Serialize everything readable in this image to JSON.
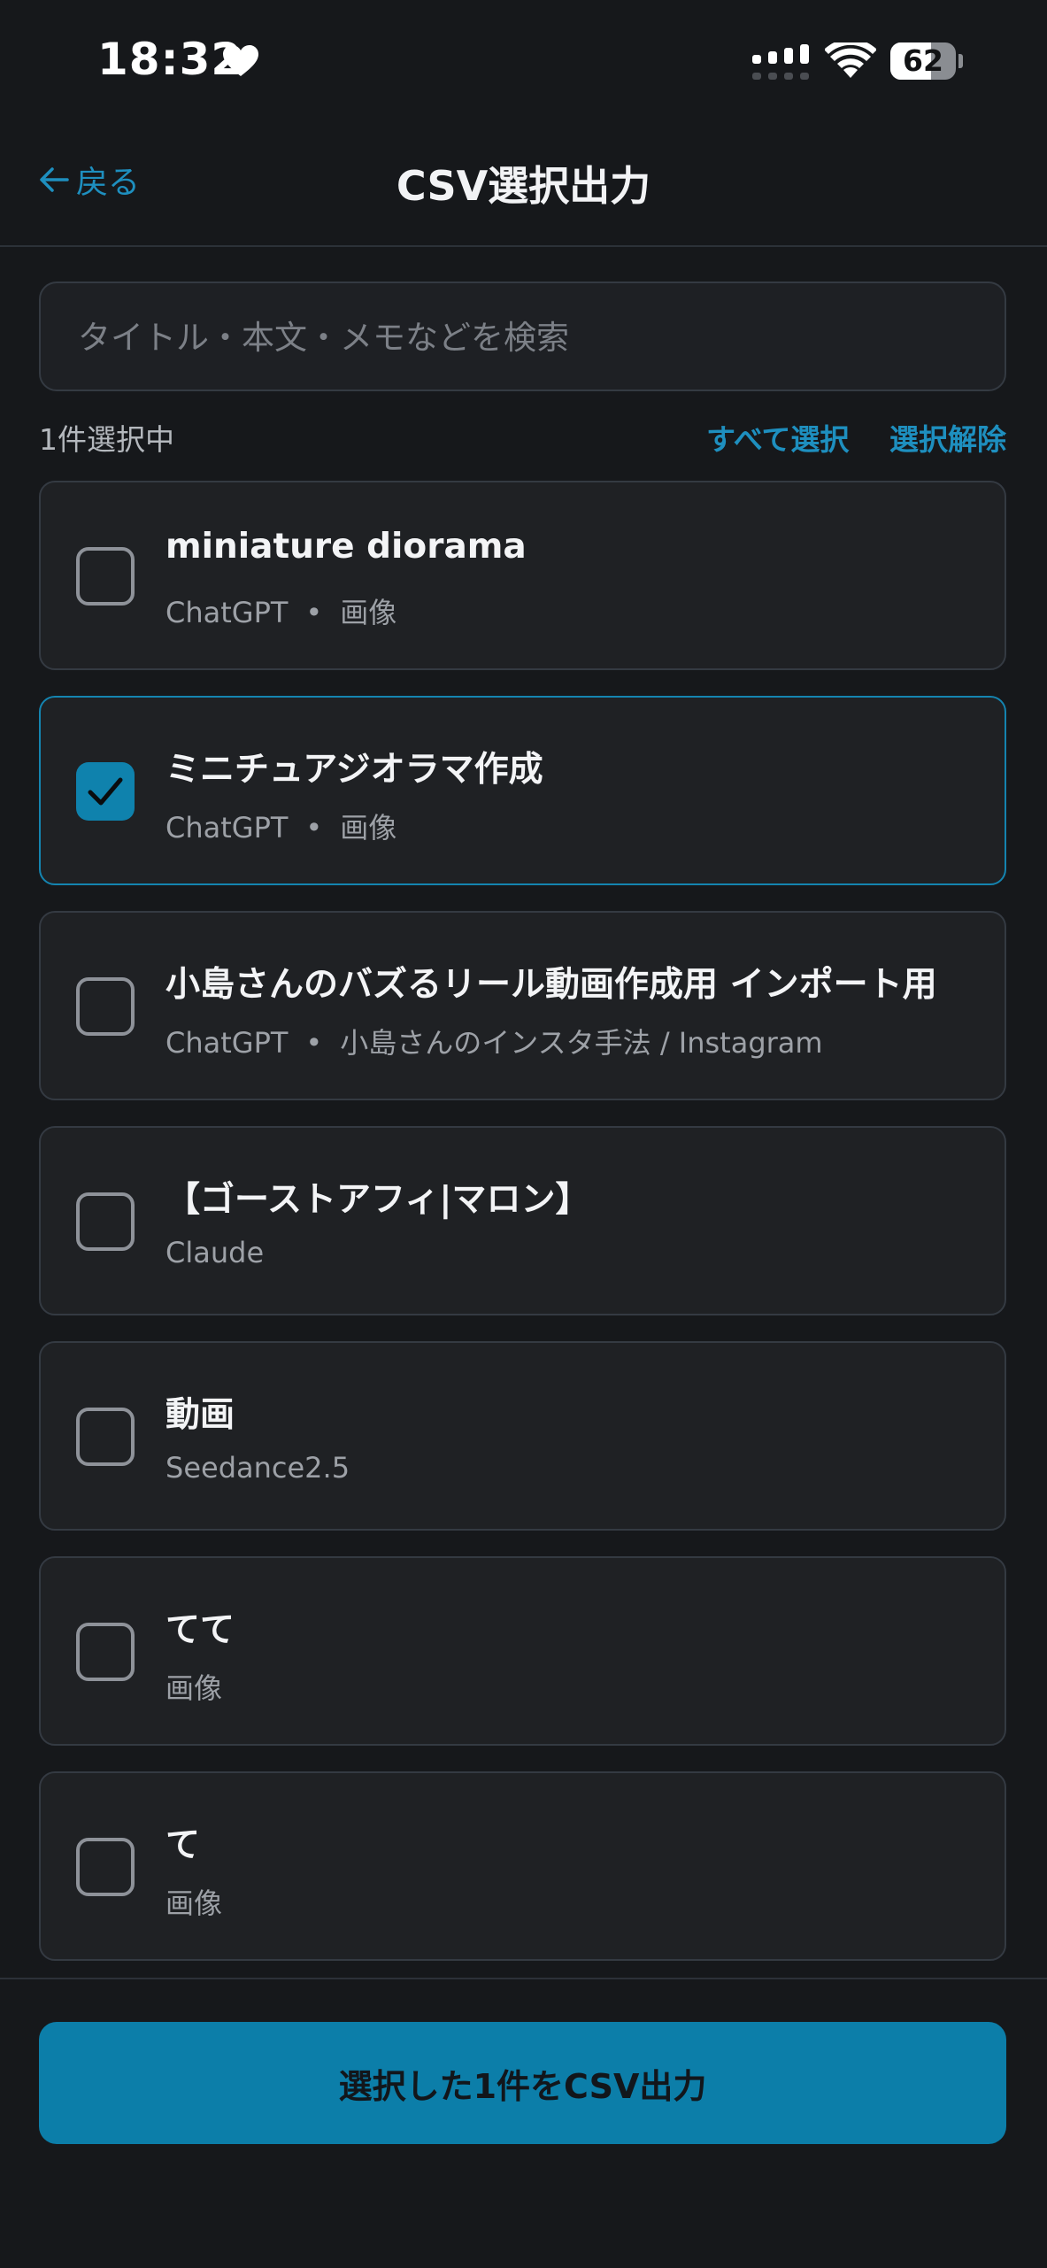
{
  "status_bar": {
    "time": "18:32",
    "battery_level": "62",
    "battery_fraction": 0.62,
    "icons": [
      "heart-icon",
      "signal-icon",
      "wifi-icon",
      "battery-icon"
    ]
  },
  "header": {
    "back_label": "戻る",
    "title": "CSV選択出力"
  },
  "search": {
    "placeholder": "タイトル・本文・メモなどを検索",
    "value": ""
  },
  "selection": {
    "count_label": "1件選択中",
    "select_all_label": "すべて選択",
    "deselect_label": "選択解除"
  },
  "items": [
    {
      "title": "miniature diorama",
      "meta": [
        "ChatGPT",
        "画像"
      ],
      "checked": false
    },
    {
      "title": "ミニチュアジオラマ作成",
      "meta": [
        "ChatGPT",
        "画像"
      ],
      "checked": true
    },
    {
      "title": "小島さんのバズるリール動画作成用 インポート用",
      "meta": [
        "ChatGPT",
        "小島さんのインスタ手法 / Instagram"
      ],
      "checked": false
    },
    {
      "title": "【ゴーストアフィ|マロン】",
      "meta": [
        "Claude"
      ],
      "checked": false
    },
    {
      "title": "動画",
      "meta": [
        "Seedance2.5"
      ],
      "checked": false
    },
    {
      "title": "てて",
      "meta": [
        "画像"
      ],
      "checked": false
    },
    {
      "title": "て",
      "meta": [
        "画像"
      ],
      "checked": false
    }
  ],
  "footer": {
    "export_label": "選択した1件をCSV出力"
  },
  "colors": {
    "background": "#16181b",
    "card": "#1f2124",
    "accent": "#1e8fbf",
    "button": "#0c7ea9"
  }
}
